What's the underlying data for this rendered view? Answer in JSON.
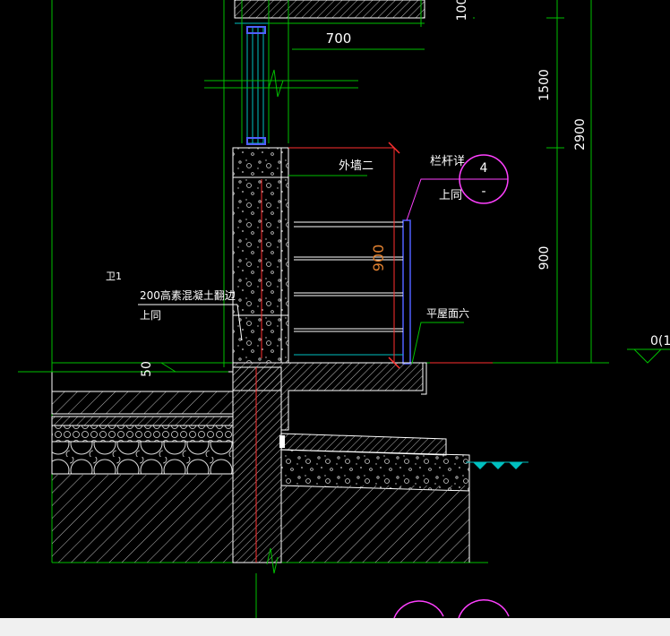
{
  "colors": {
    "background": "#000000",
    "green": "#00c000",
    "cyan": "#00c0c0",
    "white": "#ffffff",
    "red": "#ff3030",
    "magenta": "#ff40ff",
    "blue": "#5060ff",
    "orange": "#e08030",
    "gray": "#a0a0a0",
    "statusbar": "#f0f0f0"
  },
  "dimensions": {
    "d700": "700",
    "d100": "100",
    "d1500": "1500",
    "d2900": "2900",
    "d900_right": "900",
    "d900_railing": "900",
    "d50": "50"
  },
  "labels": {
    "exterior_wall": "外墙二",
    "railing_detail": "栏杆详",
    "same_above_railing": "上同",
    "detail_number": "4",
    "detail_sheet": "-",
    "concrete_curb": "200高素混凝土翻边",
    "same_above_curb": "上同",
    "flat_roof": "平屋面六",
    "room_tag": "卫1",
    "level_mark": "0(1"
  }
}
